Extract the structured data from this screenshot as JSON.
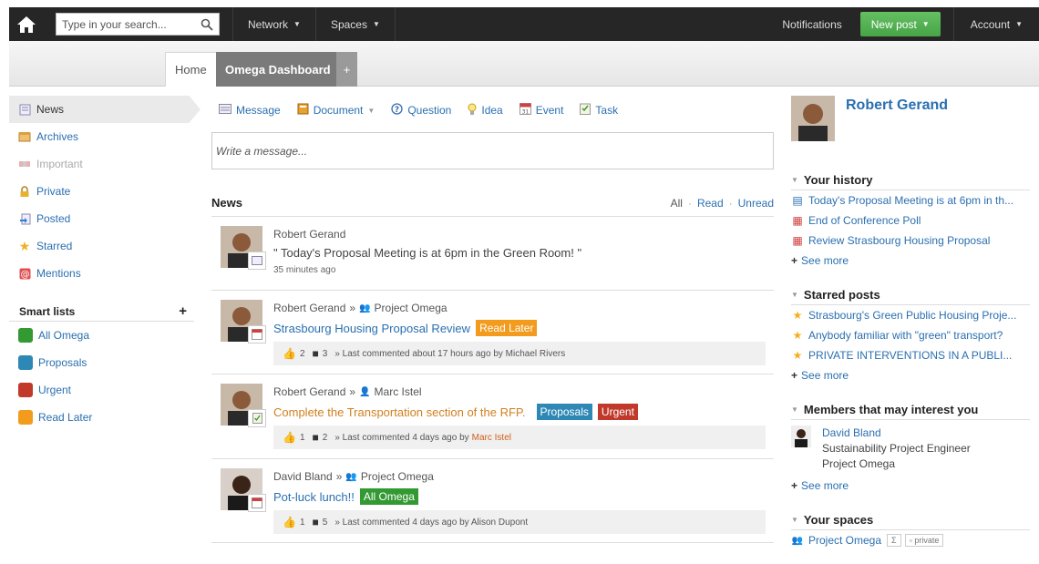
{
  "topbar": {
    "search_placeholder": "Type in your search...",
    "network_label": "Network",
    "spaces_label": "Spaces",
    "notifications_label": "Notifications",
    "newpost_label": "New post",
    "account_label": "Account"
  },
  "tabs": {
    "home": "Home",
    "omega": "Omega Dashboard",
    "add": "+"
  },
  "sidebar": {
    "items": [
      {
        "label": "News"
      },
      {
        "label": "Archives"
      },
      {
        "label": "Important"
      },
      {
        "label": "Private"
      },
      {
        "label": "Posted"
      },
      {
        "label": "Starred"
      },
      {
        "label": "Mentions"
      }
    ],
    "smart_title": "Smart lists",
    "smart_add": "+",
    "smart": [
      {
        "label": "All Omega",
        "color": "#339933"
      },
      {
        "label": "Proposals",
        "color": "#2e88b6"
      },
      {
        "label": "Urgent",
        "color": "#c0392b"
      },
      {
        "label": "Read Later",
        "color": "#f29b1d"
      }
    ]
  },
  "composer": {
    "tabs": [
      "Message",
      "Document",
      "Question",
      "Idea",
      "Event",
      "Task"
    ],
    "placeholder": "Write a message..."
  },
  "news": {
    "title": "News",
    "filters": [
      "All",
      "Read",
      "Unread"
    ],
    "posts": [
      {
        "author": "Robert Gerand",
        "body": "\" Today's Proposal Meeting is at 6pm in the Green Room! \"",
        "time": "35 minutes ago"
      },
      {
        "author": "Robert Gerand",
        "target": "Project Omega",
        "body": "Strasbourg Housing Proposal Review",
        "tag": "Read Later",
        "likes": "2",
        "comments": "3",
        "last": "» Last commented about 17 hours ago by Michael Rivers"
      },
      {
        "author": "Robert Gerand",
        "target": "Marc Istel",
        "body": "Complete the Transportation section of the RFP.",
        "tags": [
          "Proposals",
          "Urgent"
        ],
        "likes": "1",
        "comments": "2",
        "last": "» Last commented 4 days ago by",
        "last_by": "Marc Istel"
      },
      {
        "author": "David Bland",
        "target": "Project Omega",
        "body": "Pot-luck lunch!!",
        "tag": "All Omega",
        "likes": "1",
        "comments": "5",
        "last": "» Last commented 4 days ago by Alison Dupont"
      }
    ]
  },
  "profile": {
    "name": "Robert Gerand"
  },
  "history": {
    "title": "Your history",
    "items": [
      "Today's Proposal Meeting is at 6pm in th...",
      "End of Conference Poll",
      "Review Strasbourg Housing Proposal"
    ],
    "see_more": "See more"
  },
  "starred": {
    "title": "Starred posts",
    "items": [
      "Strasbourg's Green Public Housing Proje...",
      "Anybody familiar with \"green\" transport?",
      "PRIVATE INTERVENTIONS IN A PUBLI..."
    ],
    "see_more": "See more"
  },
  "members": {
    "title": "Members that may interest you",
    "name": "David Bland",
    "role": "Sustainability Project Engineer",
    "project": "Project Omega",
    "see_more": "See more"
  },
  "spaces": {
    "title": "Your spaces",
    "item": "Project Omega",
    "badge1": "Σ",
    "badge2": "private"
  },
  "icons": {
    "home": "home-icon",
    "search": "search-icon"
  }
}
